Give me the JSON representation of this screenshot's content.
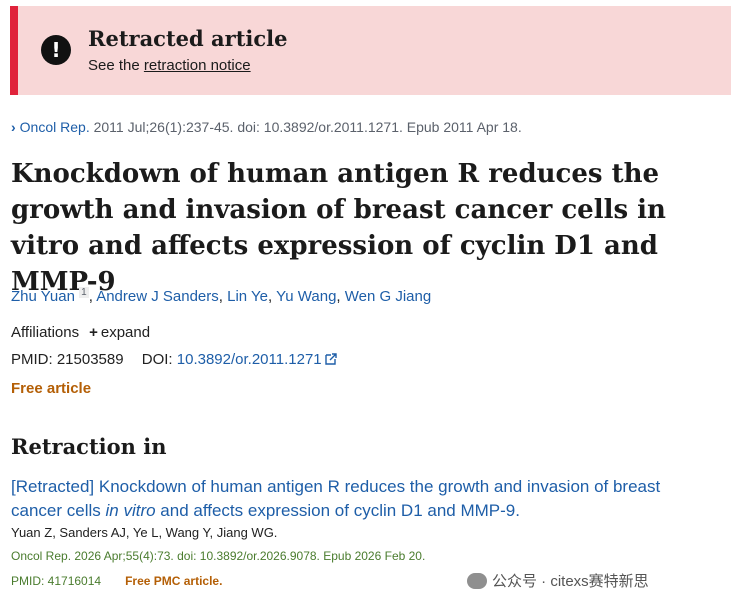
{
  "banner": {
    "title": "Retracted article",
    "sub_prefix": "See the ",
    "sub_link": "retraction notice",
    "icon": "exclamation-circle-icon"
  },
  "citation": {
    "chevron": "›",
    "journal": "Oncol Rep.",
    "rest": " 2011 Jul;26(1):237-45. doi: 10.3892/or.2011.1271. Epub 2011 Apr 18."
  },
  "article": {
    "title": "Knockdown of human antigen R reduces the growth and invasion of breast cancer cells in vitro and affects expression of cyclin D1 and MMP-9",
    "authors": [
      {
        "name": "Zhu Yuan",
        "sup": "1"
      },
      {
        "name": "Andrew J Sanders"
      },
      {
        "name": "Lin Ye"
      },
      {
        "name": "Yu Wang"
      },
      {
        "name": "Wen G Jiang"
      }
    ],
    "affiliations_label": "Affiliations",
    "expand_plus": "+",
    "expand_label": "expand",
    "pmid_label": "PMID: 21503589",
    "doi_label": "DOI:",
    "doi_link": "10.3892/or.2011.1271",
    "free_label": "Free article"
  },
  "retraction": {
    "heading": "Retraction in",
    "title_part1": "[Retracted] Knockdown of human antigen R reduces the growth and invasion of breast cancer cells ",
    "title_italic": "in vitro",
    "title_part2": " and affects expression of cyclin D1 and MMP-9.",
    "authors": "Yuan Z, Sanders AJ, Ye L, Wang Y, Jiang WG.",
    "cite": "Oncol Rep. 2026 Apr;55(4):73. doi: 10.3892/or.2026.9078. Epub 2026 Feb 20.",
    "pmid": "PMID: 41716014",
    "pmc": "Free PMC article."
  },
  "watermark": {
    "text": "公众号 · citexs赛特新思",
    "icon": "wechat-icon"
  },
  "colors": {
    "link": "#1e5ea8",
    "banner_bg": "#f8d7d7",
    "banner_accent": "#e0233b",
    "free": "#b45f06",
    "cite_green": "#4a7c2e"
  }
}
